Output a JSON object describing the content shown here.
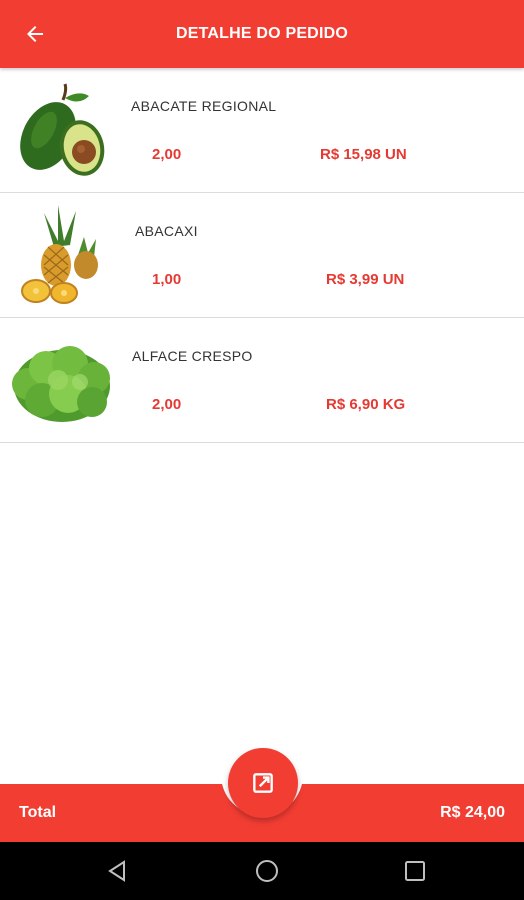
{
  "header": {
    "title": "DETALHE DO PEDIDO",
    "back_icon": "arrow-left-icon"
  },
  "items": [
    {
      "name": "ABACATE REGIONAL",
      "quantity": "2,00",
      "price": "R$ 15,98 UN",
      "image": "avocado"
    },
    {
      "name": "ABACAXI",
      "quantity": "1,00",
      "price": "R$ 3,99 UN",
      "image": "pineapple"
    },
    {
      "name": "ALFACE CRESPO",
      "quantity": "2,00",
      "price": "R$ 6,90 KG",
      "image": "lettuce"
    }
  ],
  "footer": {
    "total_label": "Total",
    "total_value": "R$ 24,00",
    "fab_icon": "edit-external-icon"
  },
  "colors": {
    "accent": "#f23d33",
    "price": "#e53a33",
    "navbar": "#000000"
  },
  "system_nav": {
    "back": "nav-back-icon",
    "home": "nav-home-icon",
    "recents": "nav-recents-icon"
  }
}
